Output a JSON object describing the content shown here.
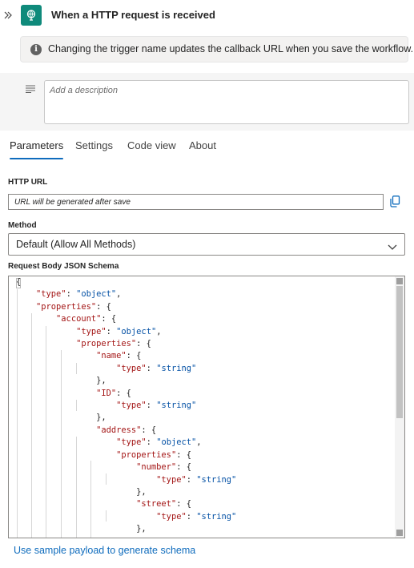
{
  "header": {
    "collapse_icon": "double-chevron-right-icon",
    "trigger_icon": "http-request-trigger-icon",
    "title": "When a HTTP request is received"
  },
  "info_bar": {
    "icon": "info-icon",
    "text": "Changing the trigger name updates the callback URL when you save the workflow."
  },
  "description": {
    "icon": "text-lines-icon",
    "placeholder": "Add a description"
  },
  "tabs": [
    {
      "label": "Parameters",
      "active": true
    },
    {
      "label": "Settings",
      "active": false
    },
    {
      "label": "Code view",
      "active": false
    },
    {
      "label": "About",
      "active": false
    }
  ],
  "http_url": {
    "label": "HTTP URL",
    "value": "URL will be generated after save",
    "copy_icon": "copy-icon"
  },
  "method": {
    "label": "Method",
    "value": "Default (Allow All Methods)",
    "icon": "chevron-down-icon"
  },
  "schema": {
    "label": "Request Body JSON Schema",
    "lines": [
      "{",
      "    \"type\": \"object\",",
      "    \"properties\": {",
      "        \"account\": {",
      "            \"type\": \"object\",",
      "            \"properties\": {",
      "                \"name\": {",
      "                    \"type\": \"string\"",
      "                },",
      "                \"ID\": {",
      "                    \"type\": \"string\"",
      "                },",
      "                \"address\": {",
      "                    \"type\": \"object\",",
      "                    \"properties\": {",
      "                        \"number\": {",
      "                            \"type\": \"string\"",
      "                        },",
      "                        \"street\": {",
      "                            \"type\": \"string\"",
      "                        },"
    ]
  },
  "sample_link": "Use sample payload to generate schema",
  "colors": {
    "accent": "#0f6cbd",
    "trigger_icon_bg": "#0f8a7b",
    "json_key": "#a31515",
    "json_string": "#0451a5"
  }
}
